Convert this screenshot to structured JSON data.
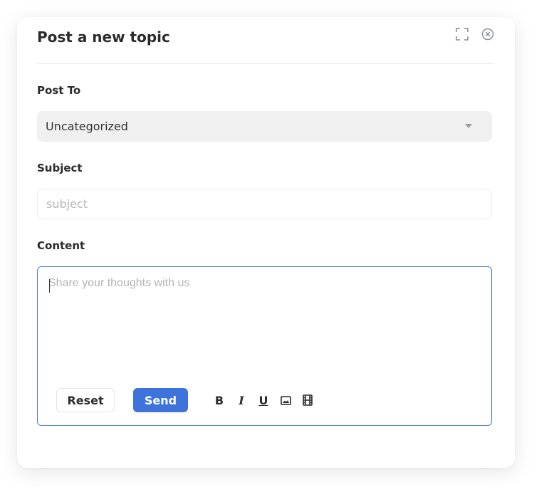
{
  "dialog": {
    "title": "Post a new topic",
    "icons": [
      "fullscreen-icon",
      "close-icon"
    ]
  },
  "post_to": {
    "label": "Post To",
    "selected": "Uncategorized"
  },
  "subject": {
    "label": "Subject",
    "placeholder": "subject",
    "value": ""
  },
  "content": {
    "label": "Content",
    "placeholder": "Share your thoughts with us",
    "value": ""
  },
  "actions": {
    "reset_label": "Reset",
    "send_label": "Send"
  },
  "toolbar": {
    "bold": "B",
    "italic": "I",
    "underline": "U",
    "tools": [
      "bold-icon",
      "italic-icon",
      "underline-icon",
      "image-icon",
      "video-icon"
    ]
  },
  "colors": {
    "accent": "#3e73dc",
    "focus_border": "#4a7fe0",
    "select_bg": "#f0f0f0"
  }
}
